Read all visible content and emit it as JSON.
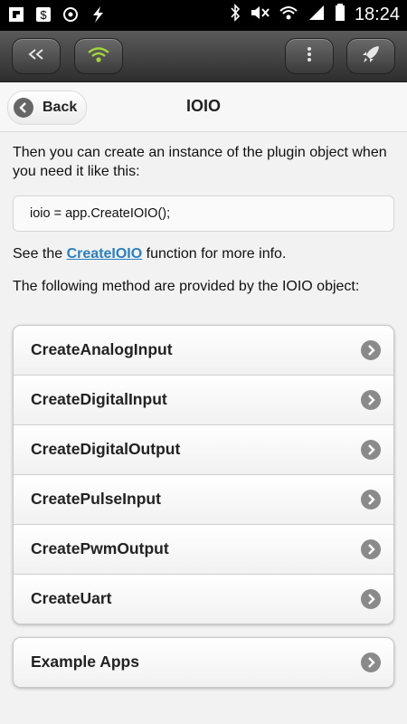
{
  "status_bar": {
    "time": "18:24"
  },
  "header": {
    "back_label": "Back",
    "title": "IOIO"
  },
  "content": {
    "intro": "Then you can create an instance of the plugin object when you need it like this:",
    "code": "ioio = app.CreateIOIO();",
    "see_prefix": "See the ",
    "see_link": "CreateIOIO",
    "see_suffix": " function for more info.",
    "methods_intro": "The following method are provided by the IOIO object:"
  },
  "methods": [
    {
      "label": "CreateAnalogInput"
    },
    {
      "label": "CreateDigitalInput"
    },
    {
      "label": "CreateDigitalOutput"
    },
    {
      "label": "CreatePulseInput"
    },
    {
      "label": "CreatePwmOutput"
    },
    {
      "label": "CreateUart"
    }
  ],
  "extras": [
    {
      "label": "Example Apps"
    }
  ],
  "colors": {
    "link": "#2a7fc0",
    "toolbar_dark": "#2e2e2e",
    "wifi_accent": "#a4d43a"
  }
}
